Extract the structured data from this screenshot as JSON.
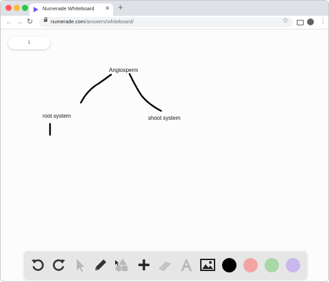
{
  "browser": {
    "tab_title": "Numerade Whiteboard",
    "tab_close": "✕",
    "new_tab": "+",
    "url_host": "numerade.com",
    "url_path": "/answers/whiteboard/"
  },
  "whiteboard": {
    "page_number": "1",
    "labels": {
      "top": "Angiosperm",
      "left": "root system",
      "right": "shoot system"
    }
  },
  "tools": {
    "icons": [
      "undo-icon",
      "redo-icon",
      "select-arrow-icon",
      "pencil-icon",
      "shapes-icon",
      "add-icon",
      "eraser-icon",
      "text-icon",
      "image-icon"
    ],
    "colors": [
      "#000000",
      "#f4a3a3",
      "#a9d7a7",
      "#c8b8ee"
    ],
    "active_color": "#000000"
  }
}
